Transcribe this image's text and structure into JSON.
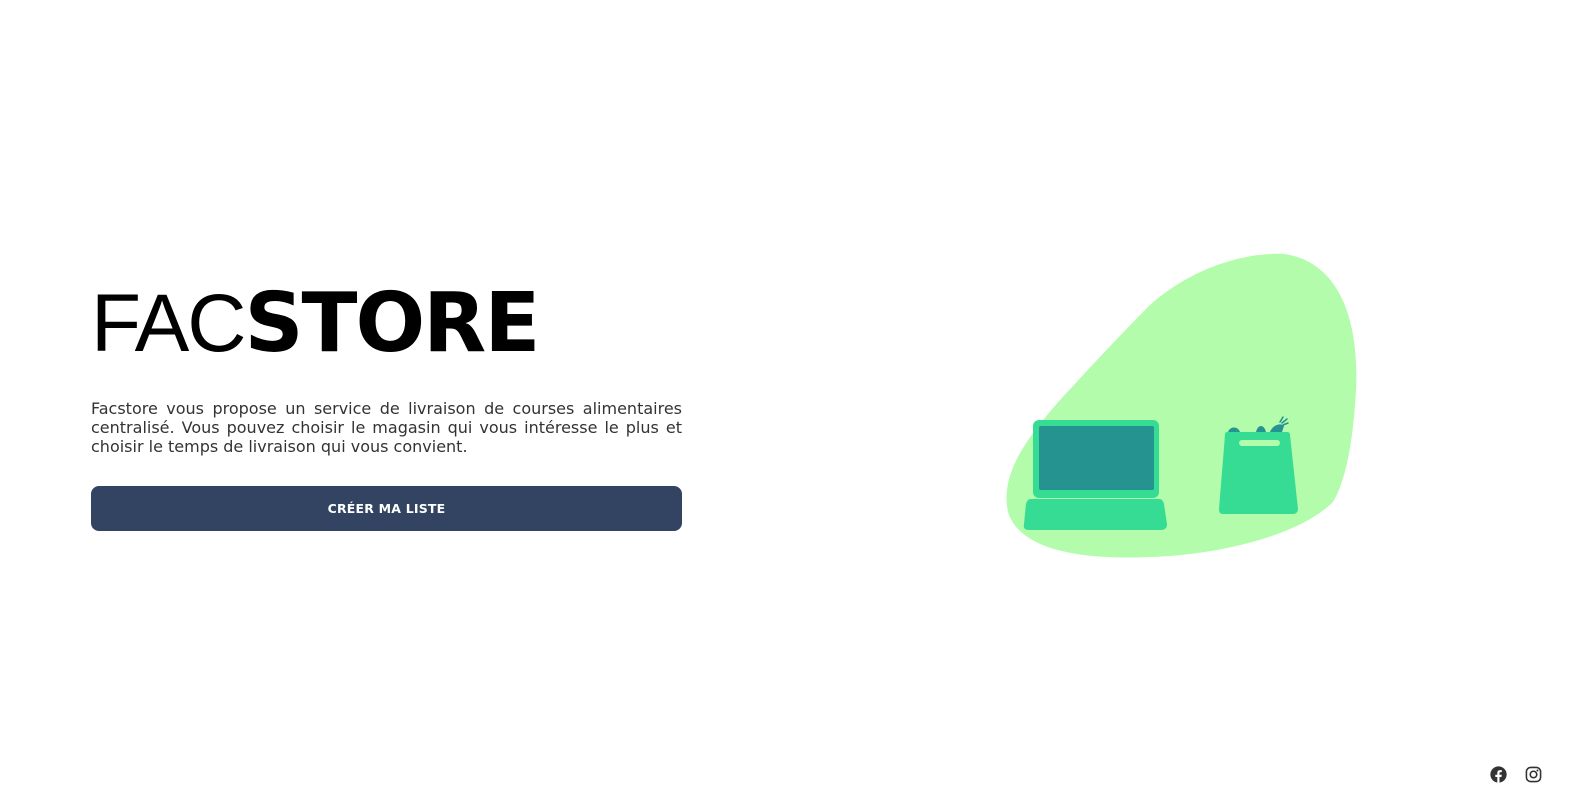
{
  "brand": {
    "logo_light": "FAC",
    "logo_bold": "STORE"
  },
  "hero": {
    "description": "Facstore vous propose un service de livraison de courses alimentaires centralisé. Vous pouvez choisir le magasin qui vous intéresse le plus et choisir le temps de livraison qui vous convient.",
    "cta_label": "CRÉER MA LISTE"
  },
  "illustration": {
    "blob_color": "#b2fcab",
    "laptop_icon": "laptop-icon",
    "bag_icon": "grocery-bag-icon",
    "accent_green": "#36dc93",
    "screen_teal": "#259390"
  },
  "social": {
    "facebook_icon": "facebook-icon",
    "instagram_icon": "instagram-icon"
  },
  "colors": {
    "button_bg": "#324462",
    "text": "#333333"
  }
}
